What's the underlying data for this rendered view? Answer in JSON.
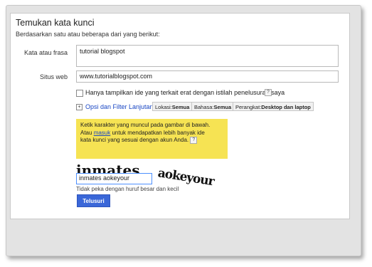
{
  "title": "Temukan kata kunci",
  "subtitle": "Berdasarkan satu atau beberapa dari yang berikut:",
  "fields": {
    "keyword_label": "Kata atau frasa",
    "keyword_value": "tutorial blogspot",
    "website_label": "Situs web",
    "website_value": "www.tutorialblogspot.com"
  },
  "checkbox_label": "Hanya tampilkan ide yang terkait erat dengan istilah penelusuran saya",
  "advanced": {
    "link_label": "Opsi dan Filter Lanjutan",
    "chips": [
      {
        "key": "Lokasi:",
        "value": "Semua"
      },
      {
        "key": "Bahasa:",
        "value": "Semua"
      },
      {
        "key": "Perangkat:",
        "value": "Desktop dan laptop"
      }
    ]
  },
  "notice": {
    "line1": "Ketik karakter yang muncul pada gambar di bawah.",
    "line2_pre": "Atau ",
    "line2_link": "masuk",
    "line2_post": " untuk mendapatkan lebih banyak ide",
    "line3": "kata kunci yang sesuai dengan akun Anda."
  },
  "captcha": {
    "word1": "inmates",
    "word2": "aokeyour",
    "answer": "inmates aokeyour"
  },
  "hint": "Tidak peka dengan huruf besar dan kecil",
  "search_button": "Telusuri",
  "help_glyph": "?",
  "plus_glyph": "+"
}
